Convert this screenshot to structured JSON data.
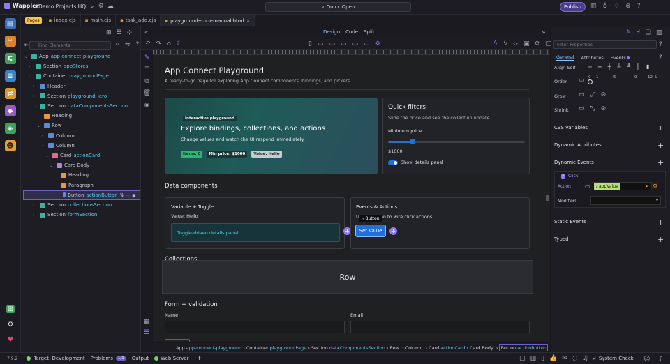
{
  "app": {
    "name": "Wappler",
    "project": "Demo Projects HQ",
    "quick_open": "Quick Open",
    "publish": "Publish"
  },
  "tabs": {
    "pages_label": "Pages",
    "files": [
      "index.ejs",
      "main.ejs",
      "task_add.ejs",
      "playground--tour-manual.html"
    ]
  },
  "design_bar": {
    "modes": [
      "Design",
      "Code",
      "Split"
    ]
  },
  "structure": {
    "find_placeholder": "Find Elements",
    "tree": [
      {
        "label": "App",
        "hl": "app-connect-playground"
      },
      {
        "label": "Section",
        "hl": "appStores"
      },
      {
        "label": "Container",
        "hl": "playgroundPage"
      },
      {
        "label": "Header",
        "hl": ""
      },
      {
        "label": "Section",
        "hl": "playgroundHero"
      },
      {
        "label": "Section",
        "hl": "dataComponentsSection"
      },
      {
        "label": "Heading",
        "hl": ""
      },
      {
        "label": "Row",
        "hl": ""
      },
      {
        "label": "Column",
        "hl": ""
      },
      {
        "label": "Column",
        "hl": ""
      },
      {
        "label": "Card",
        "hl": "actionCard"
      },
      {
        "label": "Card Body",
        "hl": ""
      },
      {
        "label": "Heading",
        "hl": ""
      },
      {
        "label": "Paragraph",
        "hl": ""
      },
      {
        "label": "Button",
        "hl": "actionButton"
      },
      {
        "label": "Section",
        "hl": "collectionsSection"
      },
      {
        "label": "Section",
        "hl": "formSection"
      }
    ]
  },
  "page": {
    "title": "App Connect Playground",
    "subtitle": "A ready-to-go page for exploring App Connect components, bindings, and pickers.",
    "hero": {
      "badge": "Interactive playground",
      "title": "Explore bindings, collections, and actions",
      "text": "Change values and watch the UI respond immediately.",
      "pills": [
        "Items: 0",
        "Min price: $1000",
        "Value: Hello"
      ]
    },
    "filters": {
      "title": "Quick filters",
      "text": "Slide the price and see the collection update.",
      "min_price_label": "Minimum price",
      "min_price_value": "$1000",
      "slider_fraction": 0.18,
      "toggle_label": "Show details panel"
    },
    "data_heading": "Data components",
    "var_card": {
      "title": "Variable + Toggle",
      "value": "Value: Hello",
      "panel": "Toggle-driven details panel."
    },
    "events_card": {
      "title": "Events & Actions",
      "text_prefix": "U",
      "text_suffix": "tton to wire click actions.",
      "tooltip": "Button",
      "button": "Set Value"
    },
    "collections_heading": "Collections",
    "row_overlay": "Row",
    "form": {
      "heading": "Form + validation",
      "name_label": "Name",
      "email_label": "Email"
    }
  },
  "breadcrumb": [
    {
      "t": "App",
      "hl": "app-connect-playground"
    },
    {
      "t": "Container",
      "hl": "playgroundPage"
    },
    {
      "t": "Section",
      "hl": "dataComponentsSection"
    },
    {
      "t": "Row",
      "hl": ""
    },
    {
      "t": "Column",
      "hl": ""
    },
    {
      "t": "Card",
      "hl": "actionCard"
    },
    {
      "t": "Card Body",
      "hl": ""
    },
    {
      "t": "Button",
      "hl": "actionButton"
    }
  ],
  "props": {
    "filter_placeholder": "Filter Properties",
    "tabs": [
      "General",
      "Attributes",
      "Events"
    ],
    "align_self": "Align Self",
    "order": "Order",
    "order_ticks": [
      "0",
      "F",
      "1",
      "5",
      "9",
      "12",
      "L"
    ],
    "grow": "Grow",
    "shrink": "Shrink",
    "sections": [
      "CSS Variables",
      "Dynamic Attributes",
      "Dynamic Events",
      "Static Events",
      "Typed"
    ],
    "event_click": "Click",
    "action_label": "Action",
    "action_value": "appValue",
    "modifiers_label": "Modifiers"
  },
  "status": {
    "version": "7.9.2",
    "target": "Target: Development",
    "problems": "Problems",
    "problems_count": "1/1",
    "output": "Output",
    "web_server": "Web Server",
    "system_check": "System Check"
  },
  "colors": {
    "accent": "#8b7cf6",
    "primary": "#1f6fe0",
    "hero": "#1f5b58",
    "link": "#5ec8e8"
  }
}
